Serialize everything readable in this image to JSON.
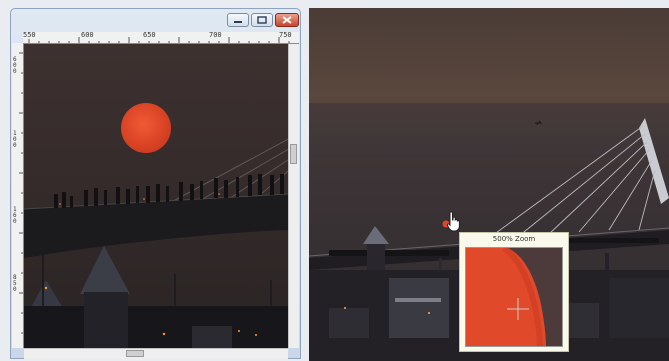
{
  "viewer_window": {
    "ruler_top_labels": [
      "550",
      "600",
      "650",
      "700",
      "750"
    ],
    "ruler_left_labels": [
      "6",
      "0",
      "0",
      "1",
      "0",
      "0",
      "1",
      "6",
      "0",
      "8",
      "5",
      "0"
    ],
    "controls": {
      "minimize_icon": "minimize-icon",
      "maximize_icon": "maximize-icon",
      "close_icon": "close-icon"
    }
  },
  "zoom_popup": {
    "title": "500% Zoom"
  },
  "colors": {
    "sky_top": "#3d3130",
    "sky_bottom": "#2a2424",
    "sun": "#e2452a",
    "zoom_panel": "#fafaec",
    "titlebar": "#cfdcec"
  }
}
